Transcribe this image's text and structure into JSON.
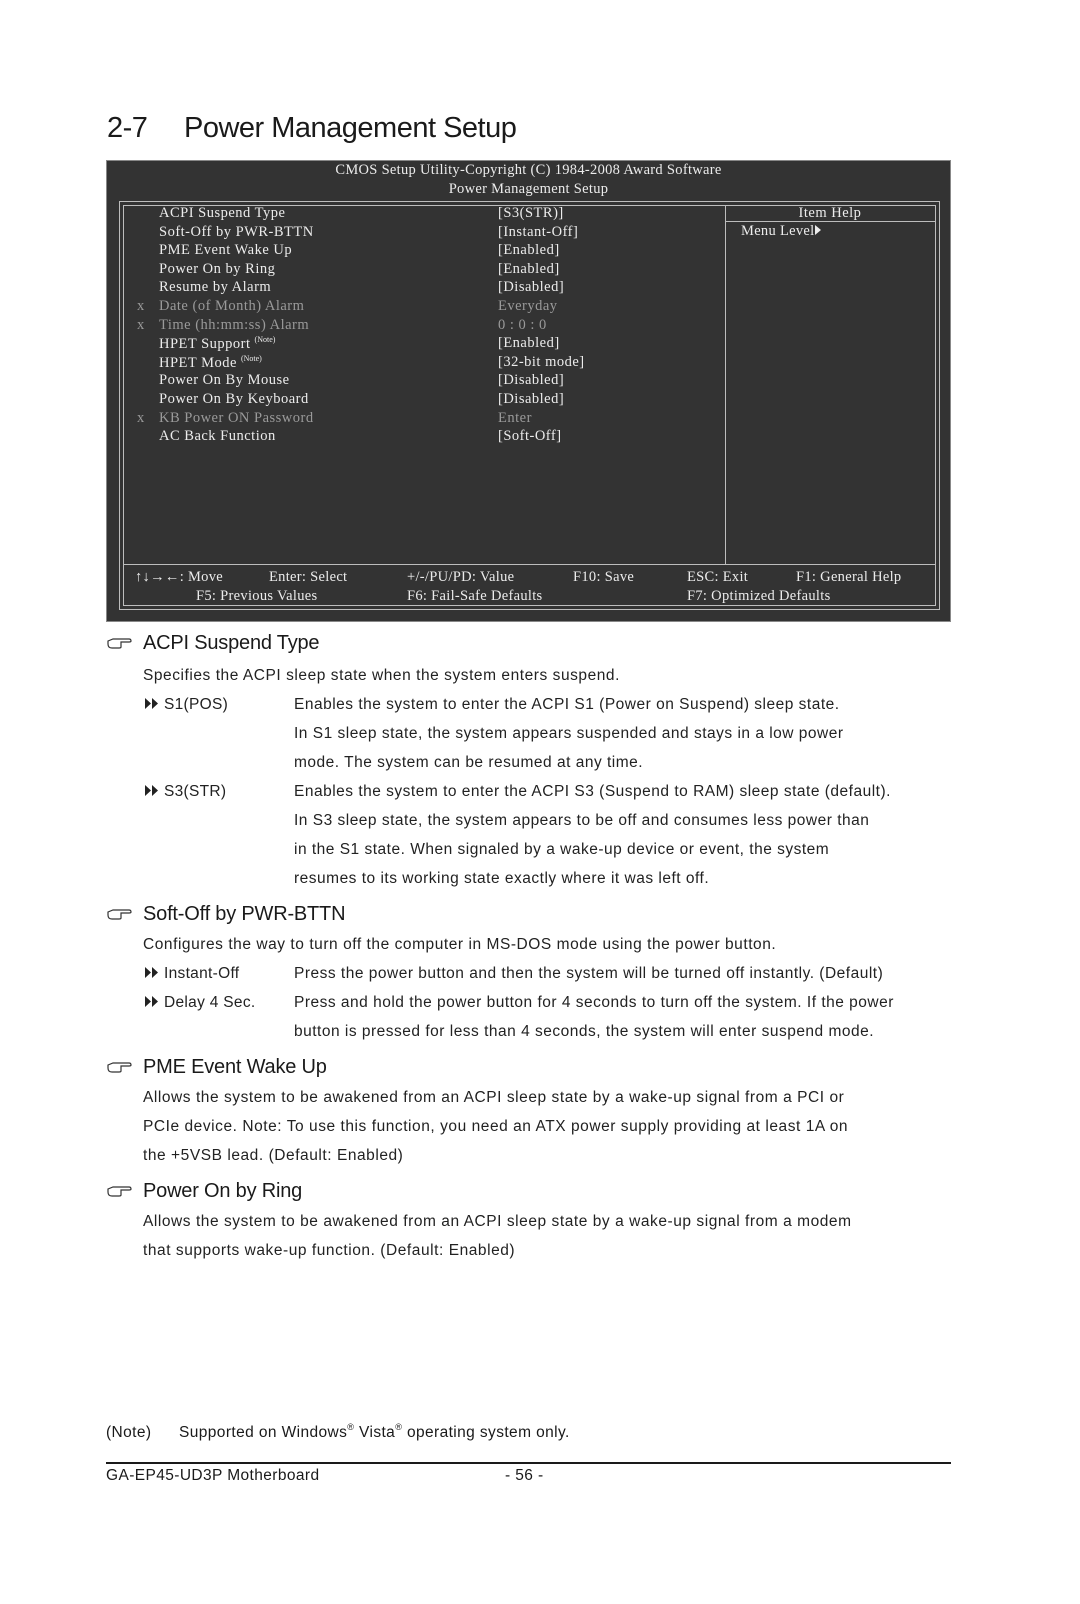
{
  "section": {
    "number": "2-7",
    "title": "Power Management Setup"
  },
  "bios": {
    "header_line1": "CMOS Setup Utility-Copyright (C) 1984-2008 Award Software",
    "header_line2": "Power Management Setup",
    "items": [
      {
        "prefix": "",
        "label": "ACPI Suspend Type",
        "note": "",
        "value": "[S3(STR)]",
        "disabled": false
      },
      {
        "prefix": "",
        "label": "Soft-Off by PWR-BTTN",
        "note": "",
        "value": "[Instant-Off]",
        "disabled": false
      },
      {
        "prefix": "",
        "label": "PME Event Wake Up",
        "note": "",
        "value": "[Enabled]",
        "disabled": false
      },
      {
        "prefix": "",
        "label": "Power On by Ring",
        "note": "",
        "value": "[Enabled]",
        "disabled": false
      },
      {
        "prefix": "",
        "label": "Resume by Alarm",
        "note": "",
        "value": "[Disabled]",
        "disabled": false
      },
      {
        "prefix": "x",
        "label": "Date (of Month) Alarm",
        "note": "",
        "value": "Everyday",
        "disabled": true
      },
      {
        "prefix": "x",
        "label": "Time (hh:mm:ss) Alarm",
        "note": "",
        "value": "0 : 0 : 0",
        "disabled": true
      },
      {
        "prefix": "",
        "label": "HPET Support",
        "note": "(Note)",
        "value": "[Enabled]",
        "disabled": false
      },
      {
        "prefix": "",
        "label": "HPET Mode",
        "note": "(Note)",
        "value": "[32-bit mode]",
        "disabled": false
      },
      {
        "prefix": "",
        "label": "Power On By Mouse",
        "note": "",
        "value": "[Disabled]",
        "disabled": false
      },
      {
        "prefix": "",
        "label": "Power On By Keyboard",
        "note": "",
        "value": "[Disabled]",
        "disabled": false
      },
      {
        "prefix": "x",
        "label": "KB Power ON Password",
        "note": "",
        "value": "Enter",
        "disabled": true
      },
      {
        "prefix": "",
        "label": "AC Back Function",
        "note": "",
        "value": "[Soft-Off]",
        "disabled": false
      }
    ],
    "help": {
      "title": "Item Help",
      "menu_level": "Menu Level"
    },
    "footer": {
      "move": "↑↓→←: Move",
      "select": "Enter: Select",
      "value": "+/-/PU/PD: Value",
      "save": "F10: Save",
      "exit": "ESC: Exit",
      "general_help": "F1: General Help",
      "previous": "F5: Previous Values",
      "failsafe": "F6: Fail-Safe Defaults",
      "optimized": "F7: Optimized Defaults"
    }
  },
  "sections": {
    "acpi": {
      "title": "ACPI Suspend Type",
      "intro": "Specifies the ACPI sleep state when the system enters suspend.",
      "options": [
        {
          "name": "S1(POS)",
          "lines": [
            "Enables the system to enter the ACPI S1 (Power on Suspend) sleep state.",
            "In S1 sleep state, the system appears suspended and stays in a low power",
            "mode. The system can be resumed at any time."
          ]
        },
        {
          "name": "S3(STR)",
          "lines": [
            "Enables the system to enter the ACPI S3 (Suspend to RAM) sleep state (default).",
            "In S3 sleep state, the system appears to be off and consumes less power than",
            "in the S1 state. When signaled by a wake-up device or event, the system",
            "resumes to its working state exactly where it was left off."
          ]
        }
      ]
    },
    "softoff": {
      "title": "Soft-Off by PWR-BTTN",
      "intro": "Configures the way to turn off the computer in MS-DOS mode using the power button.",
      "options": [
        {
          "name": "Instant-Off",
          "lines": [
            "Press the power button and then the system will be turned off instantly. (Default)"
          ]
        },
        {
          "name": "Delay 4 Sec.",
          "lines": [
            "Press and hold the power button for 4 seconds to turn off the system. If the power",
            "button is pressed for less than 4 seconds, the system will enter suspend mode."
          ]
        }
      ]
    },
    "pme": {
      "title": "PME Event Wake Up",
      "lines": [
        "Allows the system to be awakened from an ACPI sleep state by a wake-up signal from a PCI or",
        "PCIe device. Note: To use this function, you need an ATX power supply providing at least 1A on",
        "the +5VSB lead. (Default: Enabled)"
      ]
    },
    "ring": {
      "title": "Power On by Ring",
      "lines": [
        "Allows the system to be awakened from an ACPI sleep state by a wake-up signal from a modem",
        "that supports wake-up function. (Default: Enabled)"
      ]
    }
  },
  "note": {
    "tag": "(Note)",
    "text_a": "Supported on Windows",
    "reg": "®",
    "text_b": " Vista",
    "text_c": " operating system only."
  },
  "footer": {
    "product": "GA-EP45-UD3P Motherboard",
    "page": "- 56 -"
  }
}
